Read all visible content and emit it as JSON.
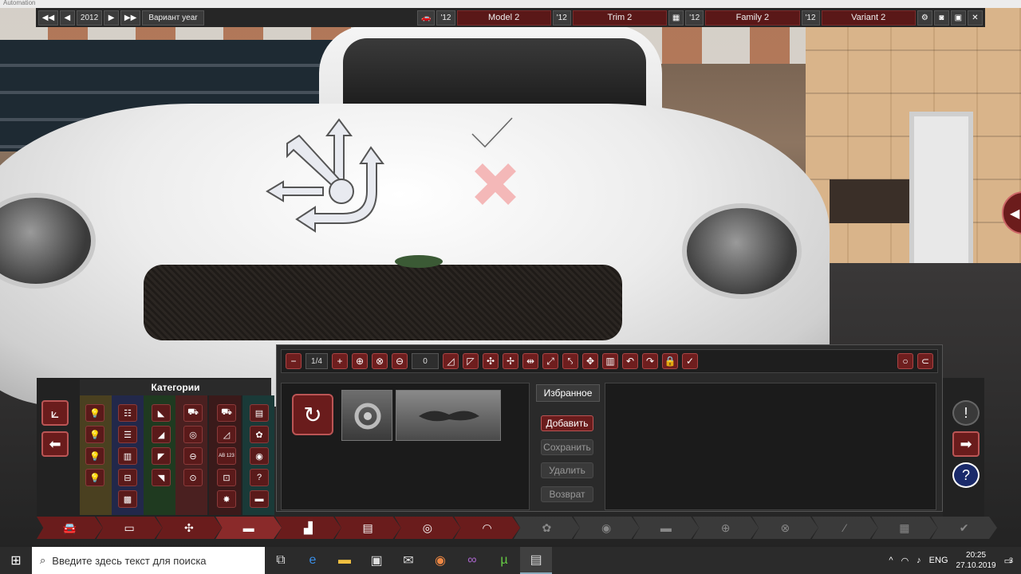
{
  "window": {
    "title": "Automation"
  },
  "topbar": {
    "year": "2012",
    "variant_year_label": "Вариант year",
    "model_year": "'12",
    "model_name": "Model 2",
    "trim_year": "'12",
    "trim_name": "Trim 2",
    "family_year": "'12",
    "family_name": "Family 2",
    "variant_year": "'12",
    "variant_name": "Variant 2"
  },
  "toolbar": {
    "page_indicator": "1/4",
    "value_field": "0"
  },
  "categories": {
    "title": "Категории"
  },
  "favorites": {
    "title": "Избранное",
    "add": "Добавить",
    "save": "Сохранить",
    "delete": "Удалить",
    "revert": "Возврат"
  },
  "category_badge_text": "AB 123",
  "colors": {
    "accent": "#6a1c1c",
    "accent_border": "#b55555",
    "panel": "#2a2a2a"
  },
  "taskbar": {
    "search_placeholder": "Введите здесь текст для поиска",
    "language": "ENG",
    "time": "20:25",
    "date": "27.10.2019",
    "notification_count": "3"
  }
}
